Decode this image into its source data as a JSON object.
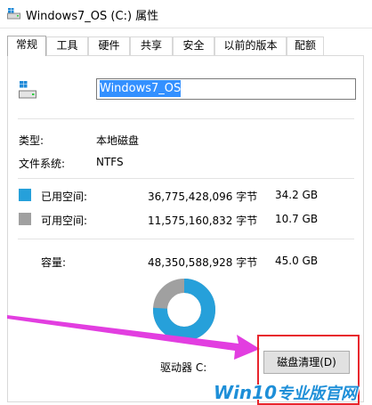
{
  "window": {
    "title": "Windows7_OS (C:) 属性"
  },
  "tabs": [
    {
      "label": "常规",
      "active": true
    },
    {
      "label": "工具",
      "active": false
    },
    {
      "label": "硬件",
      "active": false
    },
    {
      "label": "共享",
      "active": false
    },
    {
      "label": "安全",
      "active": false
    },
    {
      "label": "以前的版本",
      "active": false
    },
    {
      "label": "配额",
      "active": false
    }
  ],
  "general": {
    "drive_name": "Windows7_OS",
    "type_label": "类型:",
    "type_value": "本地磁盘",
    "fs_label": "文件系统:",
    "fs_value": "NTFS",
    "used": {
      "label": "已用空间:",
      "bytes": "36,775,428,096 字节",
      "size": "34.2 GB",
      "color": "#26a0da"
    },
    "free": {
      "label": "可用空间:",
      "bytes": "11,575,160,832 字节",
      "size": "10.7 GB",
      "color": "#a0a0a0"
    },
    "capacity": {
      "label": "容量:",
      "bytes": "48,350,588,928 字节",
      "size": "45.0 GB"
    },
    "used_fraction": 0.76,
    "drive_label": "驱动器 C:",
    "cleanup_button": "磁盘清理(D)"
  },
  "annotation": {
    "arrow_color": "#e23ee0",
    "box_color": "#e8252d"
  },
  "watermark": {
    "main": "Win10",
    "sub": "专业版官网"
  }
}
